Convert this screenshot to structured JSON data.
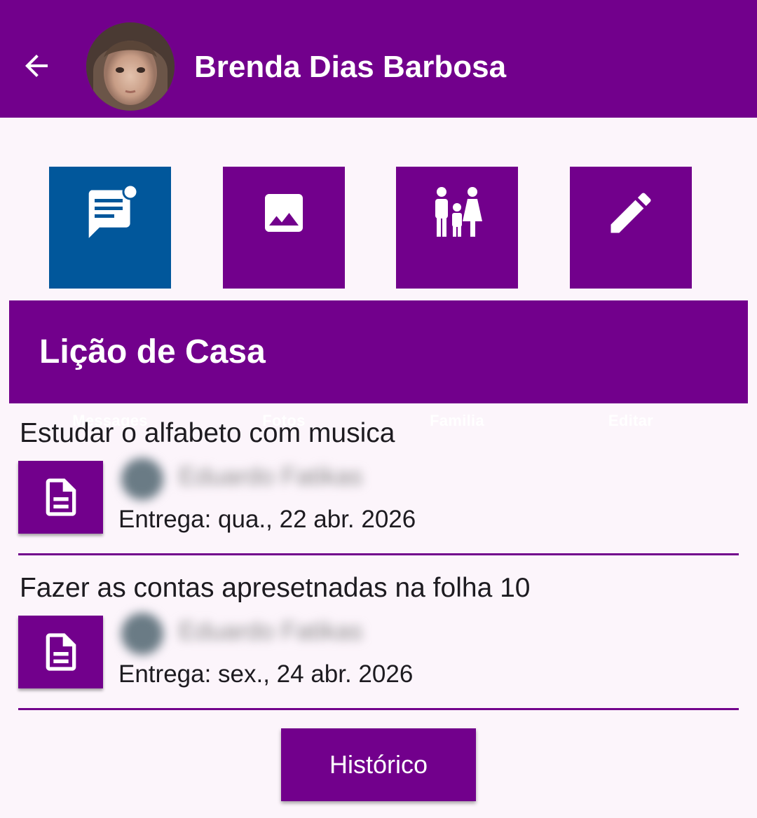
{
  "header": {
    "title": "Brenda Dias Barbosa",
    "back_icon": "arrow-back-icon",
    "avatar_alt": "student-photo"
  },
  "actions": [
    {
      "label": "Messages",
      "icon": "message-icon",
      "active": true,
      "color": "#01579b"
    },
    {
      "label": "Fotos",
      "icon": "image-icon",
      "active": false,
      "color": "#72008c"
    },
    {
      "label": "Familia",
      "icon": "family-icon",
      "active": false,
      "color": "#72008c"
    },
    {
      "label": "Editar",
      "icon": "edit-pencil-icon",
      "active": false,
      "color": "#72008c"
    }
  ],
  "section": {
    "title": "Lição de Casa"
  },
  "homework": [
    {
      "title": "Estudar o alfabeto com musica",
      "teacher": "Eduardo Fatikas",
      "due": "Entrega: qua., 22 abr. 2026",
      "icon": "document-icon"
    },
    {
      "title": "Fazer as contas apresetnadas na folha 10",
      "teacher": "Eduardo Fatikas",
      "due": "Entrega: sex., 24 abr. 2026",
      "icon": "document-icon"
    }
  ],
  "history_button": {
    "label": "Histórico"
  },
  "colors": {
    "primary": "#72008c",
    "active": "#01579b",
    "background": "#fcf5fb"
  }
}
